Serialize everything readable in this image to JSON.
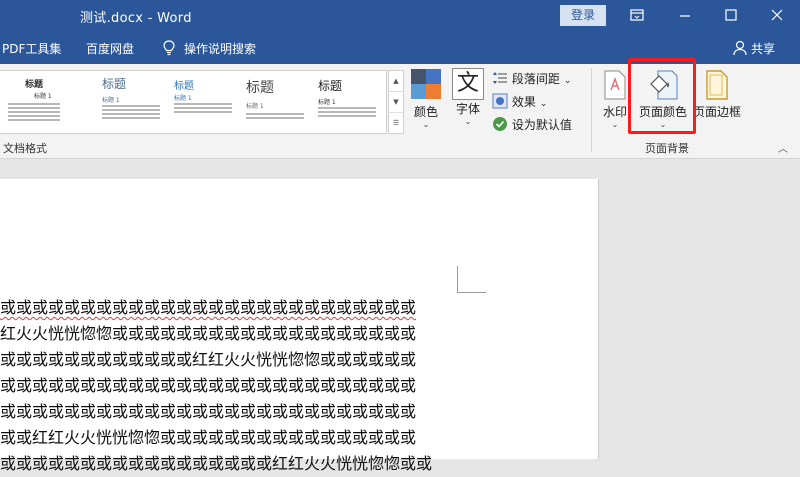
{
  "window": {
    "title": "测试.docx  -  Word",
    "login_label": "登录"
  },
  "tabs": {
    "pdf": "PDF工具集",
    "baidu": "百度网盘",
    "search_label": "操作说明搜索",
    "share_label": "共享"
  },
  "ribbon": {
    "style_gallery": [
      {
        "title": "标题",
        "subtitle": "标题 1"
      },
      {
        "title": "标题",
        "subtitle": "标题 1"
      },
      {
        "title": "标题",
        "subtitle": "标题 1"
      },
      {
        "title": "标题",
        "subtitle": "标题 1"
      },
      {
        "title": "标题",
        "subtitle": "标题 1"
      }
    ],
    "colors_label": "颜色",
    "fonts_label": "字体",
    "paragraph_spacing_label": "段落间距",
    "effects_label": "效果",
    "set_default_label": "设为默认值",
    "document_format_group": "文档格式",
    "watermark_label": "水印",
    "page_color_label": "页面颜色",
    "page_borders_label": "页面边框",
    "page_background_group": "页面背景",
    "highlight_color": "#ff1a1a",
    "font_icon_glyph": "文"
  },
  "document": {
    "lines": [
      "或或或或或或或或或或或或或或或或或或或或或或或或或或",
      "红火火恍恍惚惚或或或或或或或或或或或或或或或或或或或",
      "或或或或或或或或或或或或红红火火恍恍惚惚或或或或或或",
      "或或或或或或或或或或或或或或或或或或或或或或或或或或",
      "或或或或或或或或或或或或或或或或或或或或或或或或或或",
      "或或红红火火恍恍惚惚或或或或或或或或或或或或或或或或",
      "或或或或或或或或或或或或或或或或或红红火火恍恍惚惚或或"
    ]
  }
}
